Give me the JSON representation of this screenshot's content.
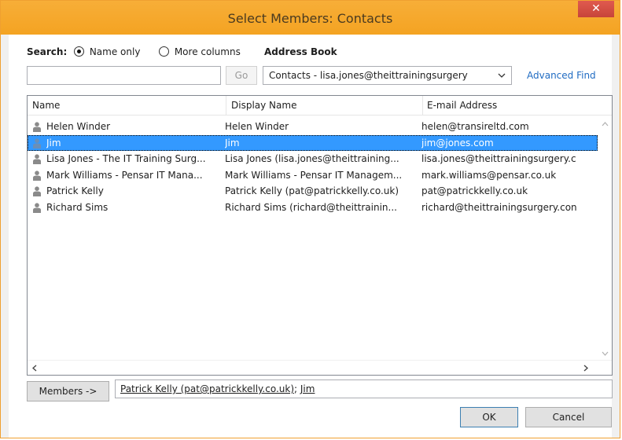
{
  "window": {
    "title": "Select Members: Contacts",
    "close_glyph": "✕"
  },
  "search": {
    "label": "Search:",
    "option_name_only": "Name only",
    "option_more_columns": "More columns",
    "selected": "Name only",
    "input_value": "",
    "go_label": "Go"
  },
  "address_book": {
    "label": "Address Book",
    "selected": "Contacts - lisa.jones@theittrainingsurgery",
    "advanced_find": "Advanced Find"
  },
  "list": {
    "columns": [
      "Name",
      "Display Name",
      "E-mail Address"
    ],
    "rows": [
      {
        "name": "Helen Winder",
        "display": "Helen Winder",
        "email": "helen@transireltd.com",
        "selected": false
      },
      {
        "name": "Jim",
        "display": "Jim",
        "email": "jim@jones.com",
        "selected": true
      },
      {
        "name": "Lisa Jones - The IT Training Surg...",
        "display": "Lisa Jones (lisa.jones@theittraining...",
        "email": "lisa.jones@theittrainingsurgery.c",
        "selected": false
      },
      {
        "name": "Mark Williams - Pensar IT Mana...",
        "display": "Mark Williams - Pensar IT Managem...",
        "email": "mark.williams@pensar.co.uk",
        "selected": false
      },
      {
        "name": "Patrick Kelly",
        "display": "Patrick Kelly (pat@patrickkelly.co.uk)",
        "email": "pat@patrickkelly.co.uk",
        "selected": false
      },
      {
        "name": "Richard Sims",
        "display": "Richard Sims (richard@theittrainin...",
        "email": "richard@theittrainingsurgery.con",
        "selected": false
      }
    ]
  },
  "members": {
    "button_label": "Members ->",
    "entries": [
      "Patrick Kelly (pat@patrickkelly.co.uk)",
      "Jim"
    ],
    "separator": "; "
  },
  "footer": {
    "ok_label": "OK",
    "cancel_label": "Cancel"
  },
  "colors": {
    "title_bar": "#f5a623",
    "close_button": "#d9534f",
    "selection": "#3399ff",
    "link": "#1f6bc2"
  }
}
